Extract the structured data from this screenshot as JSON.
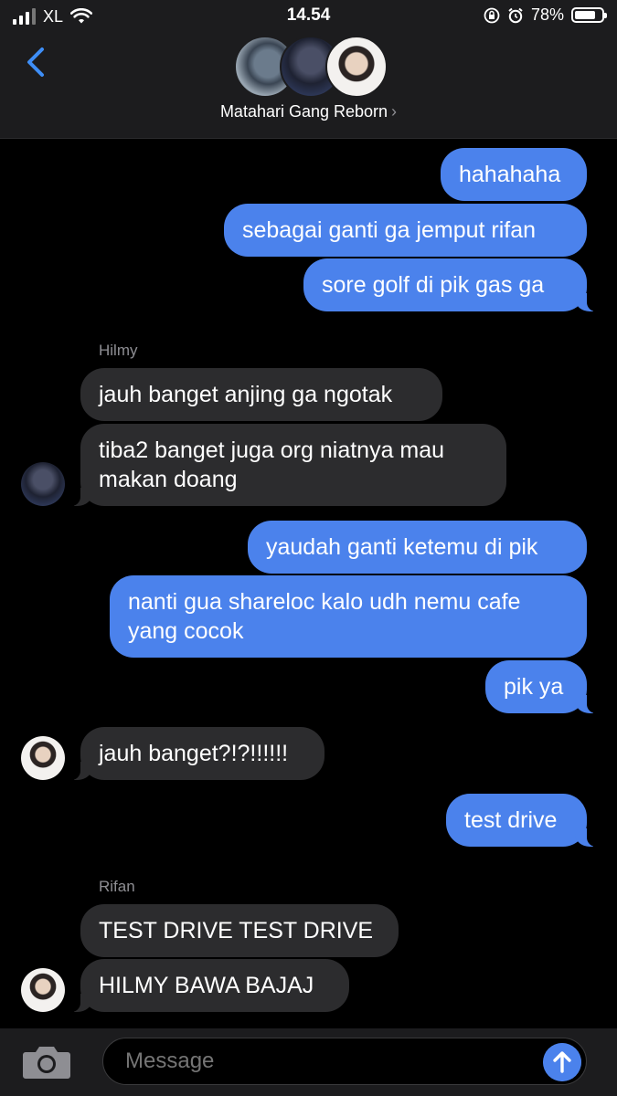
{
  "status_bar": {
    "carrier": "XL",
    "time": "14.54",
    "battery_percent_label": "78%",
    "battery_level": 0.78
  },
  "header": {
    "group_name": "Matahari Gang Reborn",
    "chevron": "›",
    "back_icon": "chevron-left-icon"
  },
  "messages": [
    {
      "dir": "out",
      "text": "hahahaha"
    },
    {
      "dir": "out",
      "text": "sebagai ganti ga jemput rifan"
    },
    {
      "dir": "out",
      "text": "sore golf di pik gas ga"
    },
    {
      "dir": "in",
      "sender": "Hilmy",
      "text": "jauh banget anjing ga ngotak"
    },
    {
      "dir": "in",
      "text": "tiba2 banget juga org niatnya mau makan doang"
    },
    {
      "dir": "out",
      "text": "yaudah ganti ketemu di pik"
    },
    {
      "dir": "out",
      "text": "nanti gua shareloc kalo udh nemu cafe yang cocok"
    },
    {
      "dir": "out",
      "text": "pik ya"
    },
    {
      "dir": "in",
      "text": "jauh banget?!?!!!!!!"
    },
    {
      "dir": "out",
      "text": "test drive"
    },
    {
      "dir": "in",
      "sender": "Rifan",
      "text": "TEST DRIVE TEST DRIVE"
    },
    {
      "dir": "in",
      "text": "HILMY BAWA BAJAJ"
    }
  ],
  "input": {
    "placeholder": "Message"
  },
  "colors": {
    "outgoing_bubble": "#4b82ec",
    "incoming_bubble": "#2c2c2e",
    "background": "#000000"
  }
}
